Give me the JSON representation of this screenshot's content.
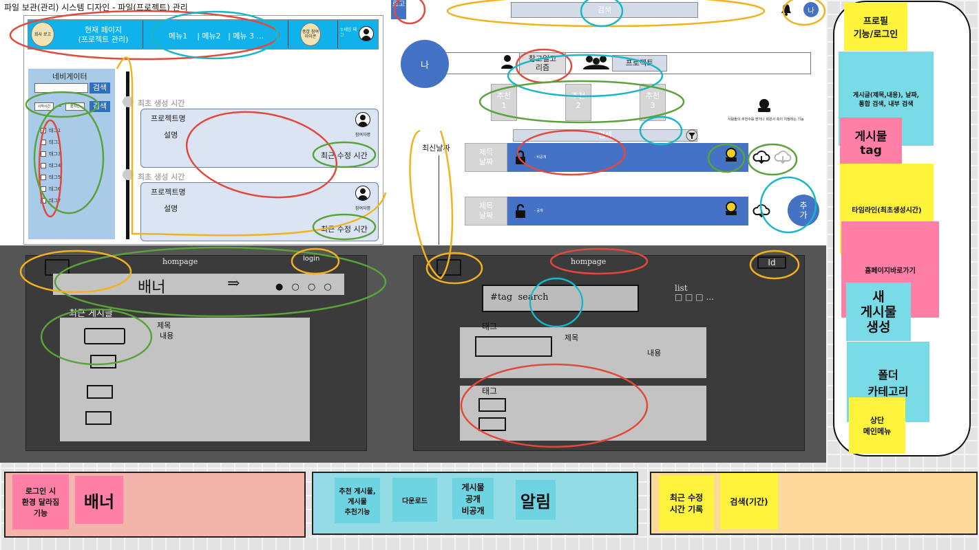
{
  "title": "파일 보관(관리) 시스템 디자인 - 파일(프로젝트) 관리",
  "left_mockup": {
    "logo": "회사 로고",
    "current_page": "현재 페이지\n(프로젝트 관리)",
    "menu": "메뉴1    | 메뉴2   | 메뉴 3 ...",
    "badge": "종합 참여 아이콘",
    "user": "누네임 태그",
    "nav_title": "네비게이터",
    "search_btn": "검색",
    "date_start": "시작시간",
    "date_sep": "~",
    "date_end": "끝시간",
    "tags": [
      "태그1",
      "태그2",
      "태그3",
      "태그4",
      "태그5",
      "태그6",
      "태그7"
    ],
    "timeline_label": "최초 생성 시간",
    "cards": [
      {
        "name": "프로젝트명",
        "desc": "설명",
        "role": "참여자명",
        "time": "최근 수정 시간"
      },
      {
        "name": "프로젝트명",
        "desc": "설명",
        "role": "참여자명",
        "time": "최근 수정 시간"
      }
    ]
  },
  "right_mockup": {
    "logo": "로고",
    "search": "검색",
    "bell": "bell-icon",
    "me": "나",
    "big_me": "나",
    "tab_ref": "참고일고\n리즘",
    "tab_project": "프로젝트",
    "recs": [
      "추천\n1",
      "추천\n2",
      "추천\n3"
    ],
    "rec_desc": "사람들의 추천수를 받거나 회원사 측이 지정하는 기능",
    "search2": "검색",
    "latest": "최신날짜",
    "rows": [
      {
        "left": "제목\n날짜",
        "label": "- 비공개"
      },
      {
        "left": "제목\n날짜",
        "label": "- 공개"
      }
    ],
    "add": "추\n가"
  },
  "sketches": {
    "left": {
      "home": "hompage",
      "login": "login",
      "banner": "배너",
      "arrow": "⇒",
      "dots": "● ○ ○ ○",
      "recent": "최근 게시글",
      "title": "제목",
      "content": "내용"
    },
    "right": {
      "home": "hompage",
      "id": "Id",
      "search": "#tag  search",
      "list": "list\n□ □ □ ...",
      "cat1": "태그",
      "title": "제목",
      "content": "내용",
      "cat2": "태그"
    }
  },
  "notes": {
    "profile": "프로필\n기능/로그인",
    "post_search": "게시글(제목,내용), 날짜,\n통합 검색, 내부 검색",
    "tag": "게시물\ntag",
    "timeline": "타임라인(최초생성시간)",
    "home": "홈페이지바로가기",
    "new_post": "새\n게시물\n생성",
    "folder": "폴더\n카테고리",
    "top_menu": "상단\n메인메뉴",
    "login_env": "로그인 시\n환경 달라짐\n기능",
    "banner": "배너",
    "recommend": "추천 게시물,\n게시물\n추천기능",
    "download": "다운로드",
    "visibility": "게시물\n공개\n비공개",
    "alarm": "알림",
    "last_mod": "최근 수정\n시간 기록",
    "period_search": "검색(기간)"
  },
  "colors": {
    "header": "#10b2ec",
    "blue": "#4472c4",
    "yellow": "#fff33b",
    "pink": "#ff7fa7",
    "cyan": "#78dbe6"
  }
}
